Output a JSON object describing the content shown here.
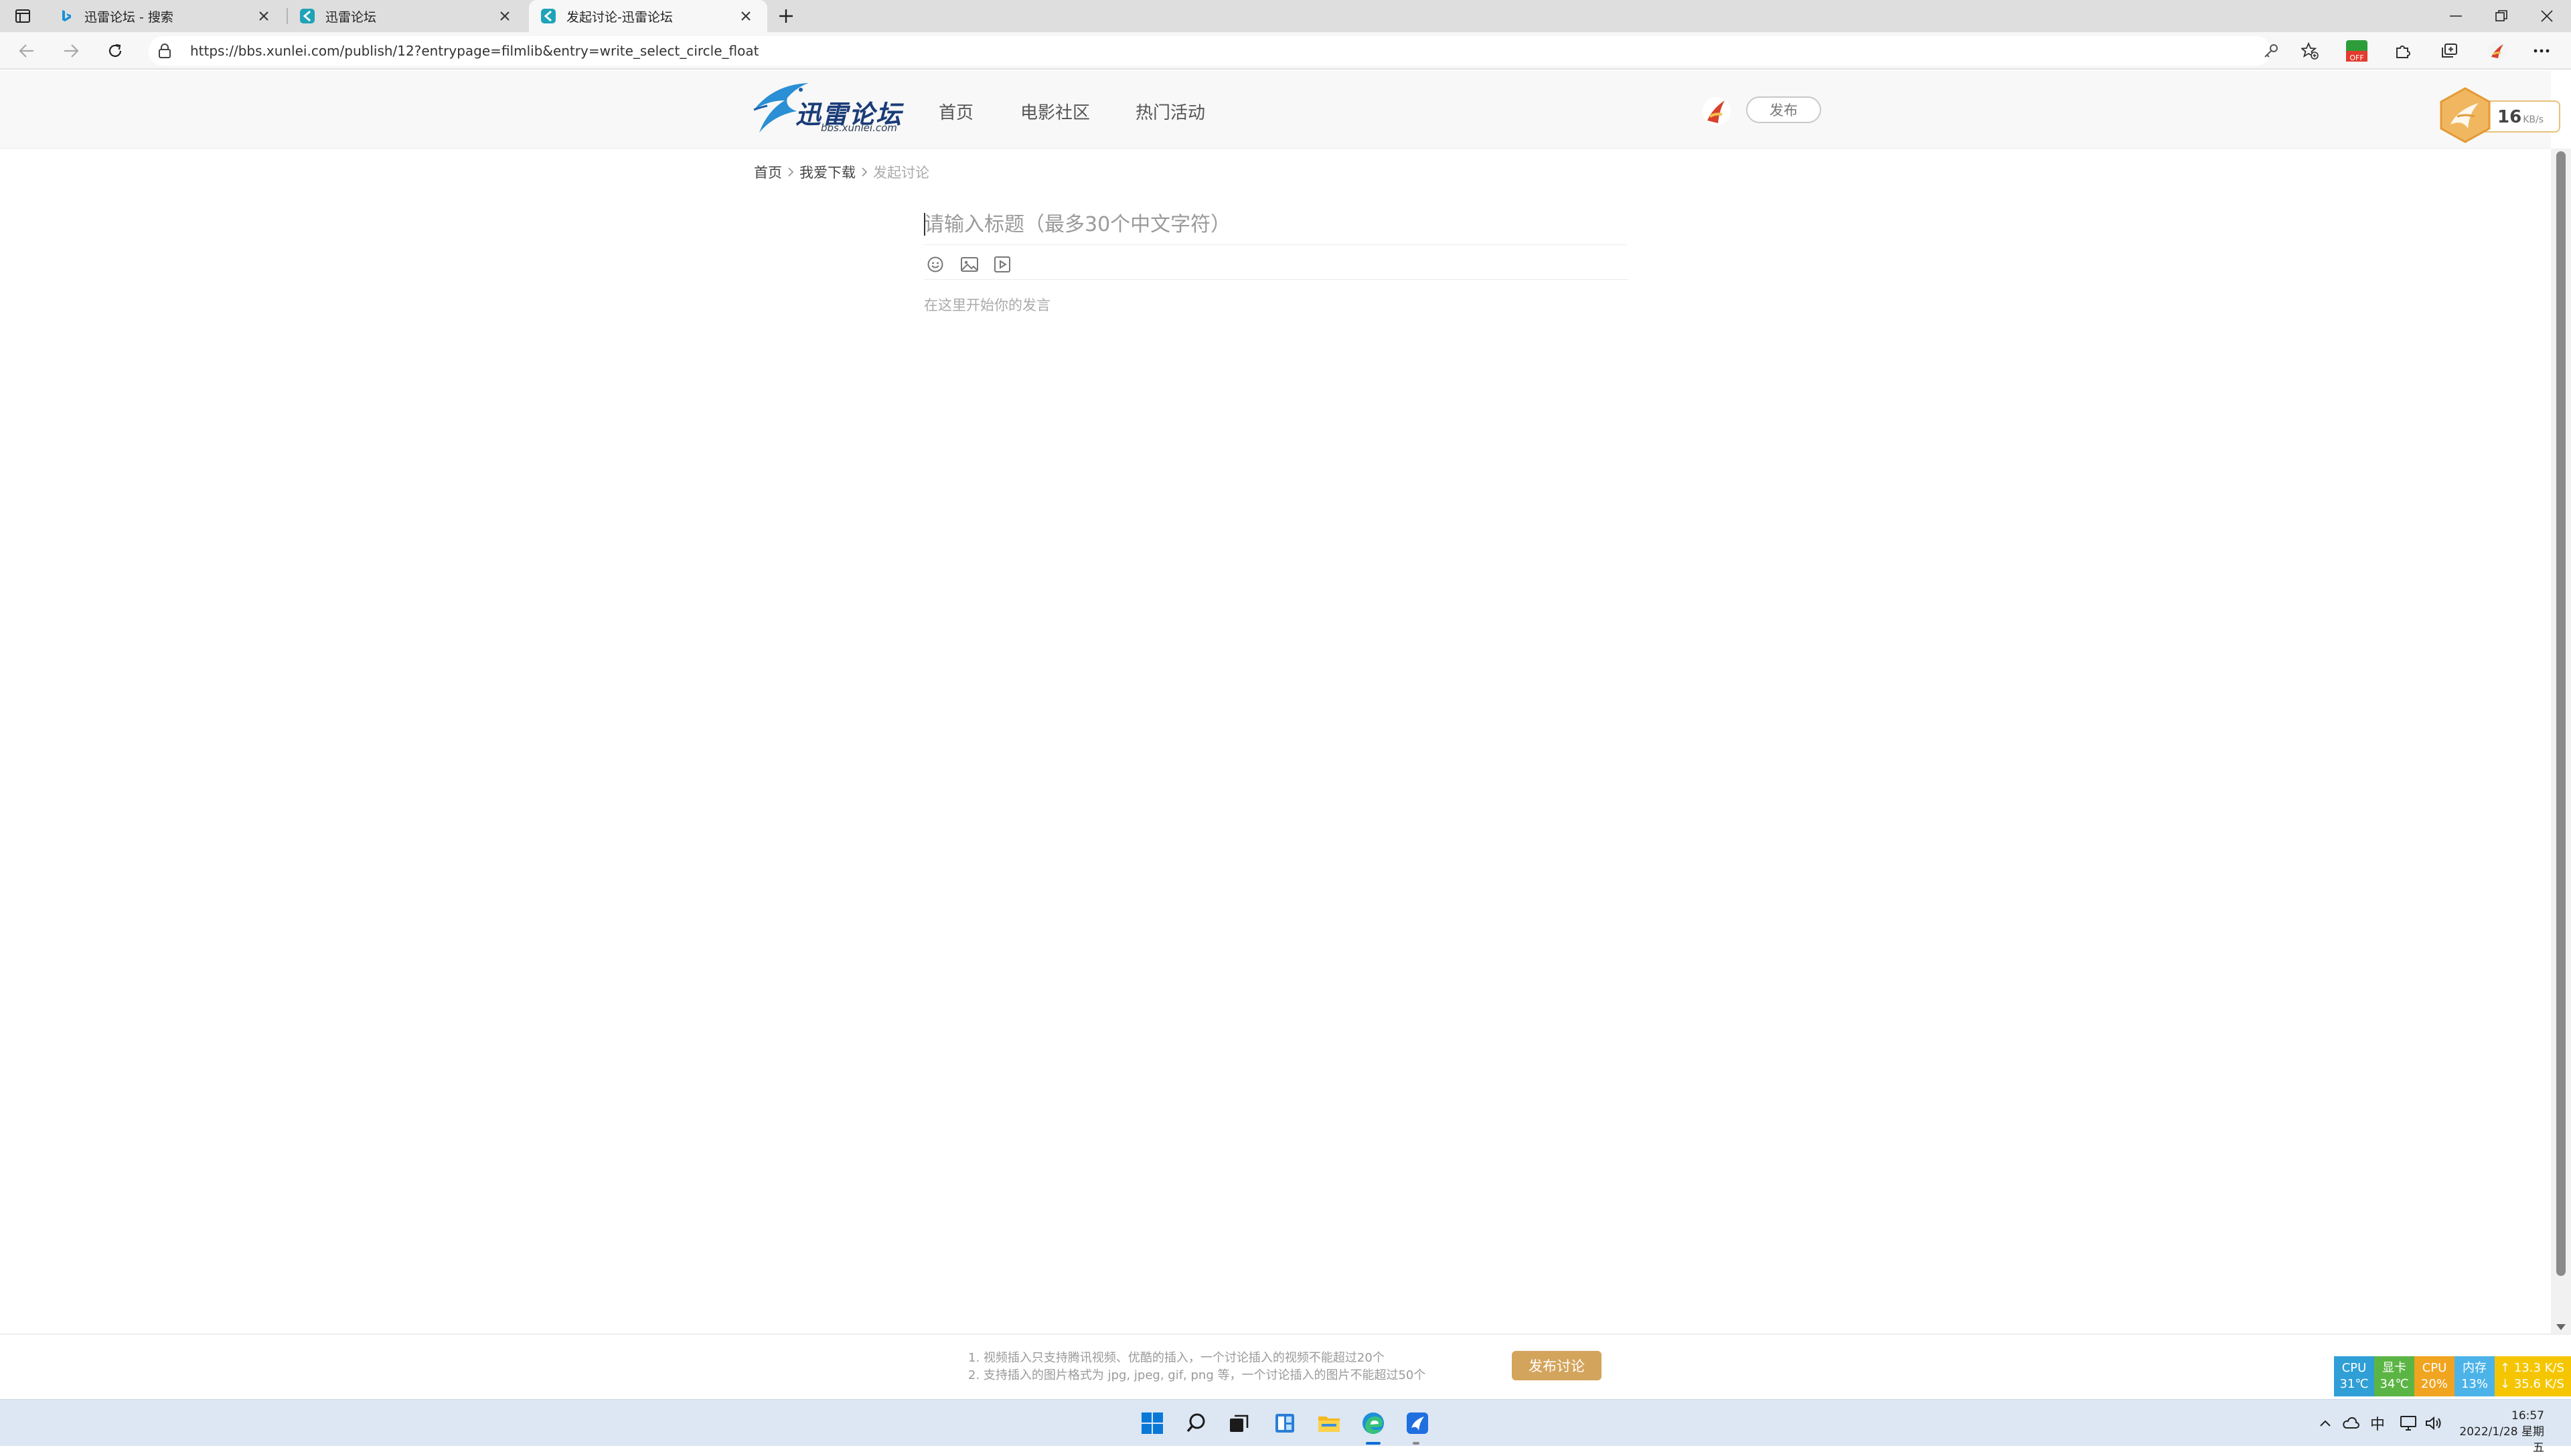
{
  "browser": {
    "tabs": [
      {
        "title": "迅雷论坛 - 搜索",
        "favicon": "bing-icon",
        "active": false
      },
      {
        "title": "迅雷论坛",
        "favicon": "xunlei-icon",
        "active": false
      },
      {
        "title": "发起讨论-迅雷论坛",
        "favicon": "xunlei-icon",
        "active": true
      }
    ],
    "url": "https://bbs.xunlei.com/publish/12?entrypage=filmlib&entry=write_select_circle_float"
  },
  "site": {
    "logo_text": "迅雷论坛",
    "logo_sub": "bbs.xunlei.com",
    "nav": [
      "首页",
      "电影社区",
      "热门活动"
    ],
    "publish_label": "发布",
    "speed_value": "16",
    "speed_unit": "KB/s"
  },
  "breadcrumb": [
    "首页",
    "我爱下载",
    "发起讨论"
  ],
  "editor": {
    "title_placeholder": "请输入标题（最多30个中文字符）",
    "body_placeholder": "在这里开始你的发言",
    "tools": [
      "emoji-icon",
      "image-icon",
      "video-icon"
    ]
  },
  "footer": {
    "note_1": "1. 视频插入只支持腾讯视频、优酷的插入，一个讨论插入的视频不能超过20个",
    "note_2": "2. 支持插入的图片格式为 jpg, jpeg, gif, png 等，一个讨论插入的图片不能超过50个",
    "submit_label": "发布讨论"
  },
  "monitor": [
    {
      "label": "CPU",
      "value": "31℃",
      "color": "#2f9fd6"
    },
    {
      "label": "显卡",
      "value": "34℃",
      "color": "#5bb544"
    },
    {
      "label": "CPU",
      "value": "20%",
      "color": "#f0a420"
    },
    {
      "label": "内存",
      "value": "13%",
      "color": "#4cb3e8"
    }
  ],
  "network": {
    "up": "13.3 K/S",
    "down": "35.6 K/S",
    "color": "#f5c600"
  },
  "taskbar": {
    "apps": [
      "windows-start-icon",
      "search-icon",
      "task-view-icon",
      "widgets-icon",
      "file-explorer-icon",
      "edge-icon",
      "xunlei-icon"
    ],
    "ime": "中",
    "time": "16:57",
    "date": "2022/1/28 星期五"
  }
}
